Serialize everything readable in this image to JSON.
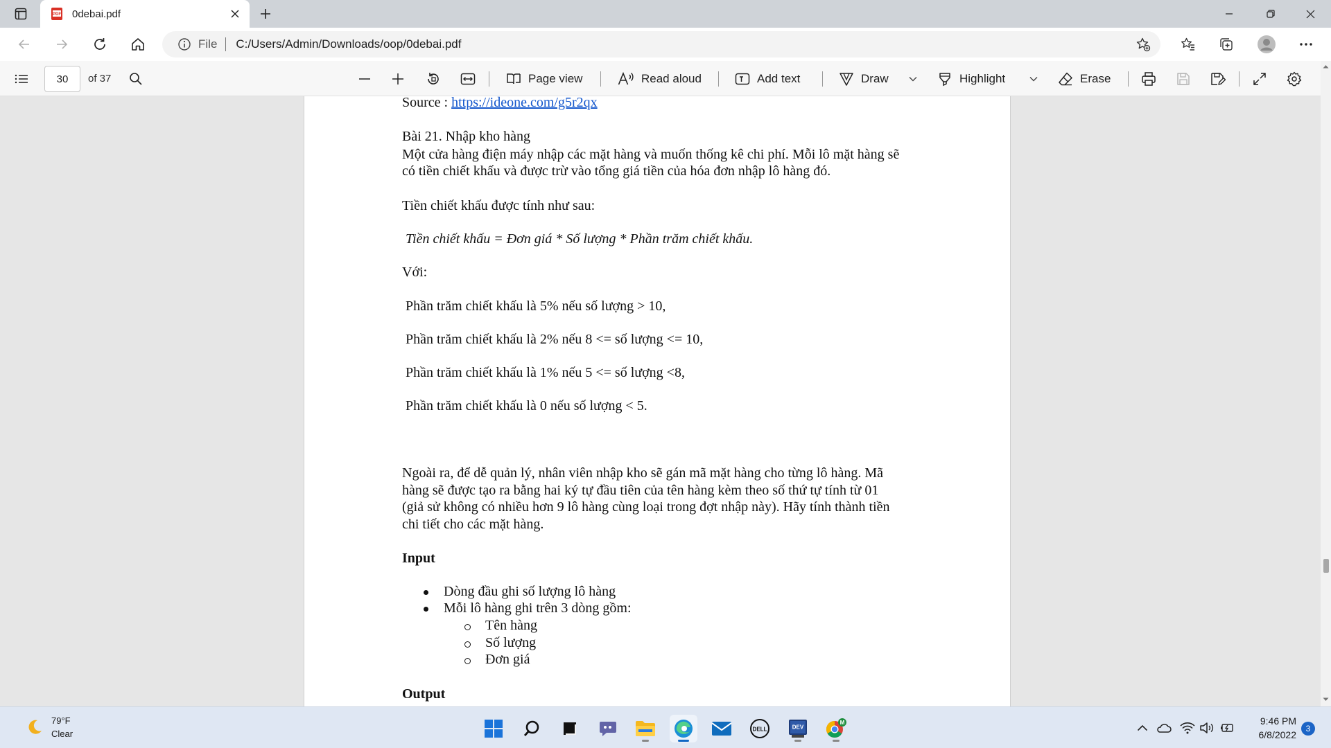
{
  "browser": {
    "tab_title": "0debai.pdf",
    "pdf_badge": "PDF",
    "address_scheme": "File",
    "address_url": "C:/Users/Admin/Downloads/oop/0debai.pdf"
  },
  "pdf_toolbar": {
    "page_number": "30",
    "page_count": "of 37",
    "page_view": "Page view",
    "read_aloud": "Read aloud",
    "add_text": "Add text",
    "draw": "Draw",
    "highlight": "Highlight",
    "erase": "Erase"
  },
  "document": {
    "source_label": "Source : ",
    "source_link": "https://ideone.com/g5r2qx",
    "heading": "Bài 21. Nhập kho hàng",
    "intro_1": "Một cửa hàng điện máy nhập các mặt hàng và muốn thống kê chi phí. Mỗi lô mặt hàng sẽ",
    "intro_2": "có tiền chiết khấu và được trừ vào tổng giá tiền của hóa đơn nhập lô hàng đó.",
    "calc_intro": "Tiền chiết khấu được tính như sau:",
    "formula": "Tiền chiết khấu = Đơn giá * Số lượng * Phần trăm chiết khấu.",
    "with_label": "Với:",
    "rules": [
      "Phần trăm chiết khấu là 5% nếu số lượng > 10,",
      "Phần trăm chiết khấu là 2% nếu 8 <= số lượng <= 10,",
      "Phần trăm chiết khấu là 1% nếu 5 <= số lượng <8,",
      "Phần trăm chiết khấu là 0 nếu số lượng < 5."
    ],
    "para2": [
      "Ngoài ra, để dễ quản lý, nhân viên nhập kho sẽ gán mã mặt hàng cho từng lô hàng. Mã",
      "hàng sẽ được tạo ra bằng hai ký tự đầu tiên của tên hàng kèm theo số thứ tự tính từ 01",
      "(giả sử không có nhiều hơn 9 lô hàng cùng loại trong đợt nhập này). Hãy tính thành tiền",
      "chi tiết cho các mặt hàng."
    ],
    "input_heading": "Input",
    "input_items": [
      "Dòng đầu ghi số lượng lô hàng",
      "Mỗi lô hàng ghi trên 3 dòng gồm:"
    ],
    "input_subitems": [
      "Tên hàng",
      "Số lượng",
      "Đơn giá"
    ],
    "output_heading": "Output"
  },
  "taskbar": {
    "weather_temp": "79°F",
    "weather_desc": "Clear",
    "time": "9:46 PM",
    "date": "6/8/2022",
    "notification_count": "3",
    "dell_label": "DELL",
    "dev_label": "DEV",
    "chrome_badge": "M"
  },
  "colors": {
    "link": "#1155cc",
    "accent": "#1067c4",
    "page_bg": "#ffffff",
    "viewer_bg": "#e6e6e6"
  }
}
